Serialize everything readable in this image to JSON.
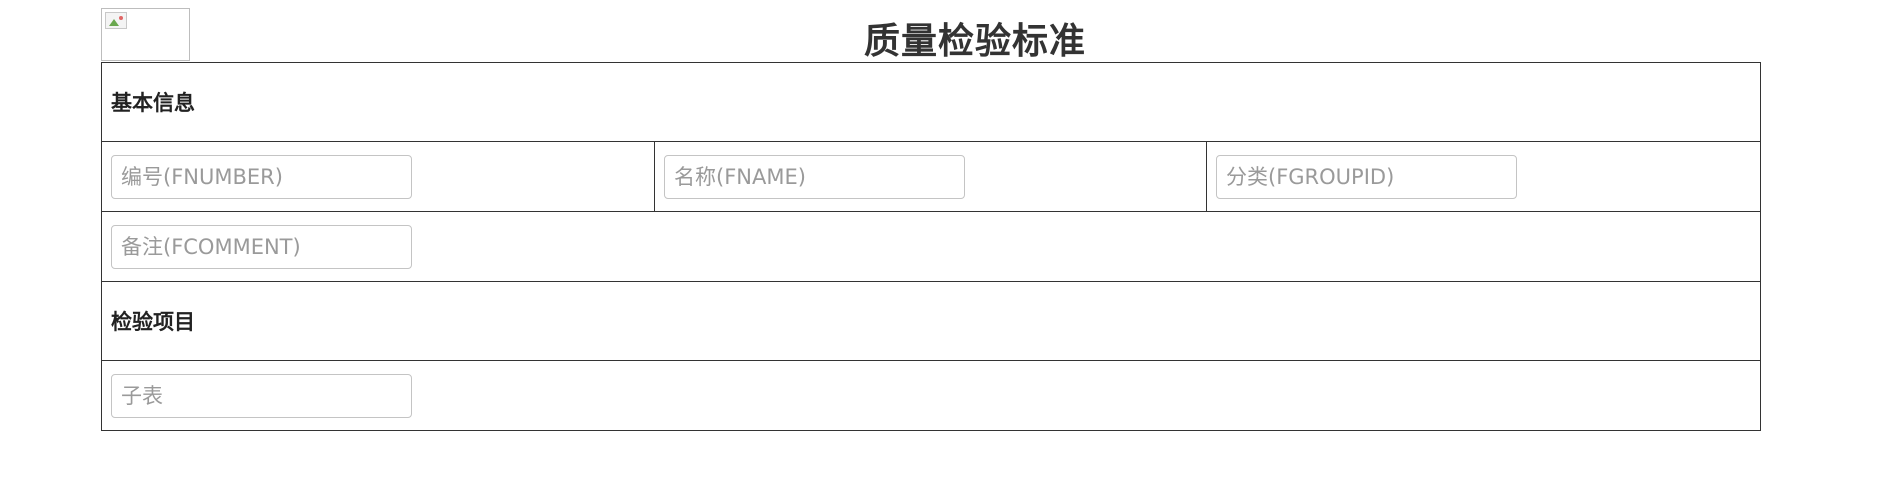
{
  "page": {
    "title": "质量检验标准"
  },
  "sections": {
    "basic_info": "基本信息",
    "inspection_items": "检验项目"
  },
  "fields": {
    "number": {
      "placeholder": "编号(FNUMBER)"
    },
    "name": {
      "placeholder": "名称(FNAME)"
    },
    "group": {
      "placeholder": "分类(FGROUPID)"
    },
    "comment": {
      "placeholder": "备注(FCOMMENT)"
    },
    "subtable": {
      "placeholder": "子表"
    }
  },
  "icons": {
    "logo": "broken-image-icon"
  }
}
